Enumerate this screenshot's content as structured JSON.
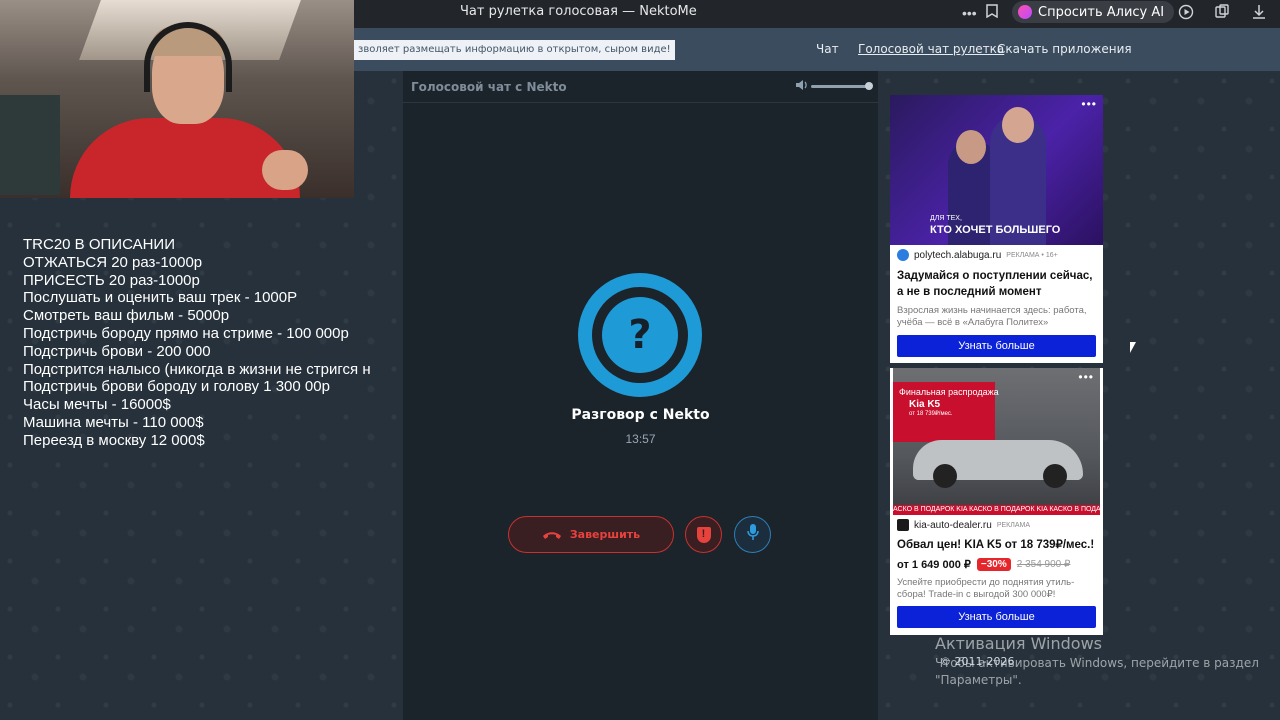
{
  "browser": {
    "title": "Чат рулетка голосовая — NektoMe",
    "alice_label": "Спросить Алису AI"
  },
  "site": {
    "notice": "зволяет размещать информацию в открытом, сыром виде!",
    "nav": [
      "Чат",
      "Голосовой чат рулетка",
      "Скачать приложения"
    ]
  },
  "overlay": {
    "lines": [
      "TRC20 В ОПИСАНИИ",
      "ОТЖАТЬСЯ 20 раз-1000р",
      "ПРИСЕСТЬ 20 раз-1000р",
      "Послушать и оценить ваш трек - 1000Р",
      "Смотреть ваш фильм - 5000р",
      "Подстричь бороду прямо на стриме - 100 000р",
      "Подстричь брови - 200 000",
      "Подстрится налысо (никогда в жизни не стригся н",
      "Подстричь брови бороду и голову 1 300 00р",
      "Часы мечты - 16000$",
      "Машина мечты - 110 000$",
      "Переезд в москву 12 000$"
    ]
  },
  "chat": {
    "title": "Голосовой чат с Nekto",
    "avatar_symbol": "?",
    "conversation_title": "Разговор с Nekto",
    "timer": "13:57",
    "end_label": "Завершить",
    "volume_level": 1.0
  },
  "ads": [
    {
      "image_caption_small": "ДЛЯ ТЕХ,",
      "image_caption_big": "КТО ХОЧЕТ БОЛЬШЕГО",
      "source": "polytech.alabuga.ru",
      "tag": "РЕКЛАМА • 16+",
      "heading": "Задумайся о поступлении сейчас, а не в последний момент",
      "description": "Взрослая жизнь начинается здесь: работа, учёба — всё в «Алабуга Политех»",
      "cta": "Узнать больше"
    },
    {
      "banner_line1": "Финальная распродажа",
      "banner_line2": "Kia K5",
      "banner_line3": "от 18 739₽/мес.",
      "strip": "АСКО В ПОДАРОК KIA КАСКО В ПОДАРОК KIA КАСКО В ПОДАРОК",
      "source": "kia-auto-dealer.ru",
      "tag": "РЕКЛАМА",
      "heading": "Обвал цен! KIA K5 от 18 739₽/мес.!",
      "price": "от 1 649 000 ₽",
      "discount": "−30%",
      "old_price": "2 354 900 ₽",
      "description": "Успейте приобрести до поднятия утиль­сбора! Trade-in с выгодой 300 000₽!",
      "cta": "Узнать больше"
    }
  ],
  "watermark": {
    "title": "Активация Windows",
    "subtitle": "Чтобы активировать Windows, перейдите в раздел \"Параметры\"."
  },
  "footer": {
    "copyright": "© 2011-2026"
  }
}
